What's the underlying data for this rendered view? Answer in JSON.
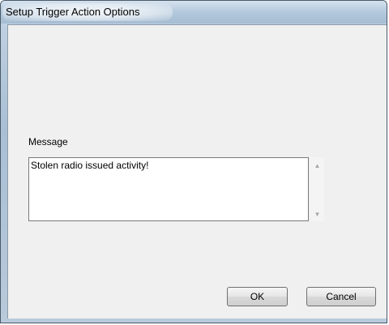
{
  "window": {
    "title": "Setup Trigger Action Options"
  },
  "form": {
    "message_label": "Message",
    "message_value": "Stolen radio issued activity!"
  },
  "scrollbar": {
    "up_icon": "▲",
    "down_icon": "▼"
  },
  "buttons": {
    "ok_label": "OK",
    "cancel_label": "Cancel"
  }
}
